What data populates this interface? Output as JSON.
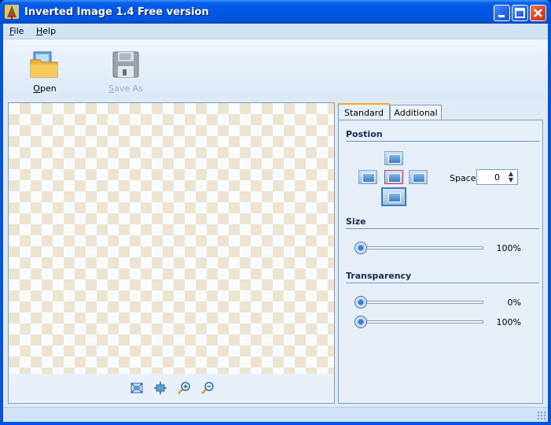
{
  "window": {
    "title": "Inverted Image 1.4 Free version",
    "icon": "app-tree-icon"
  },
  "menu": {
    "items": [
      {
        "label": "File",
        "accel": "F",
        "rest": "ile"
      },
      {
        "label": "Help",
        "accel": "H",
        "rest": "elp"
      }
    ]
  },
  "toolbar": {
    "open": {
      "label": "Open",
      "accel": "O",
      "rest": "pen",
      "icon": "open-folder-icon",
      "enabled": true
    },
    "save_as": {
      "label": "Save As",
      "accel": "S",
      "rest": "ave As",
      "icon": "save-disk-icon",
      "enabled": false
    }
  },
  "canvas": {
    "zoom_buttons": [
      "fit-window-icon",
      "actual-size-icon",
      "zoom-in-icon",
      "zoom-out-icon"
    ]
  },
  "tabs": [
    {
      "label": "Standard",
      "active": true
    },
    {
      "label": "Additional",
      "active": false
    }
  ],
  "position": {
    "title": "Postion",
    "space_label": "Space",
    "space_value": "0",
    "selected": "bottom"
  },
  "size": {
    "title": "Size",
    "value": "100%",
    "fraction": 0
  },
  "transparency": {
    "title": "Transparency",
    "slider1_value": "0%",
    "slider1_fraction": 0,
    "slider2_value": "100%",
    "slider2_fraction": 0
  },
  "colors": {
    "title_bar": "#0058e6",
    "accent": "#f5a623",
    "panel_bg": "#dfeaf6"
  }
}
